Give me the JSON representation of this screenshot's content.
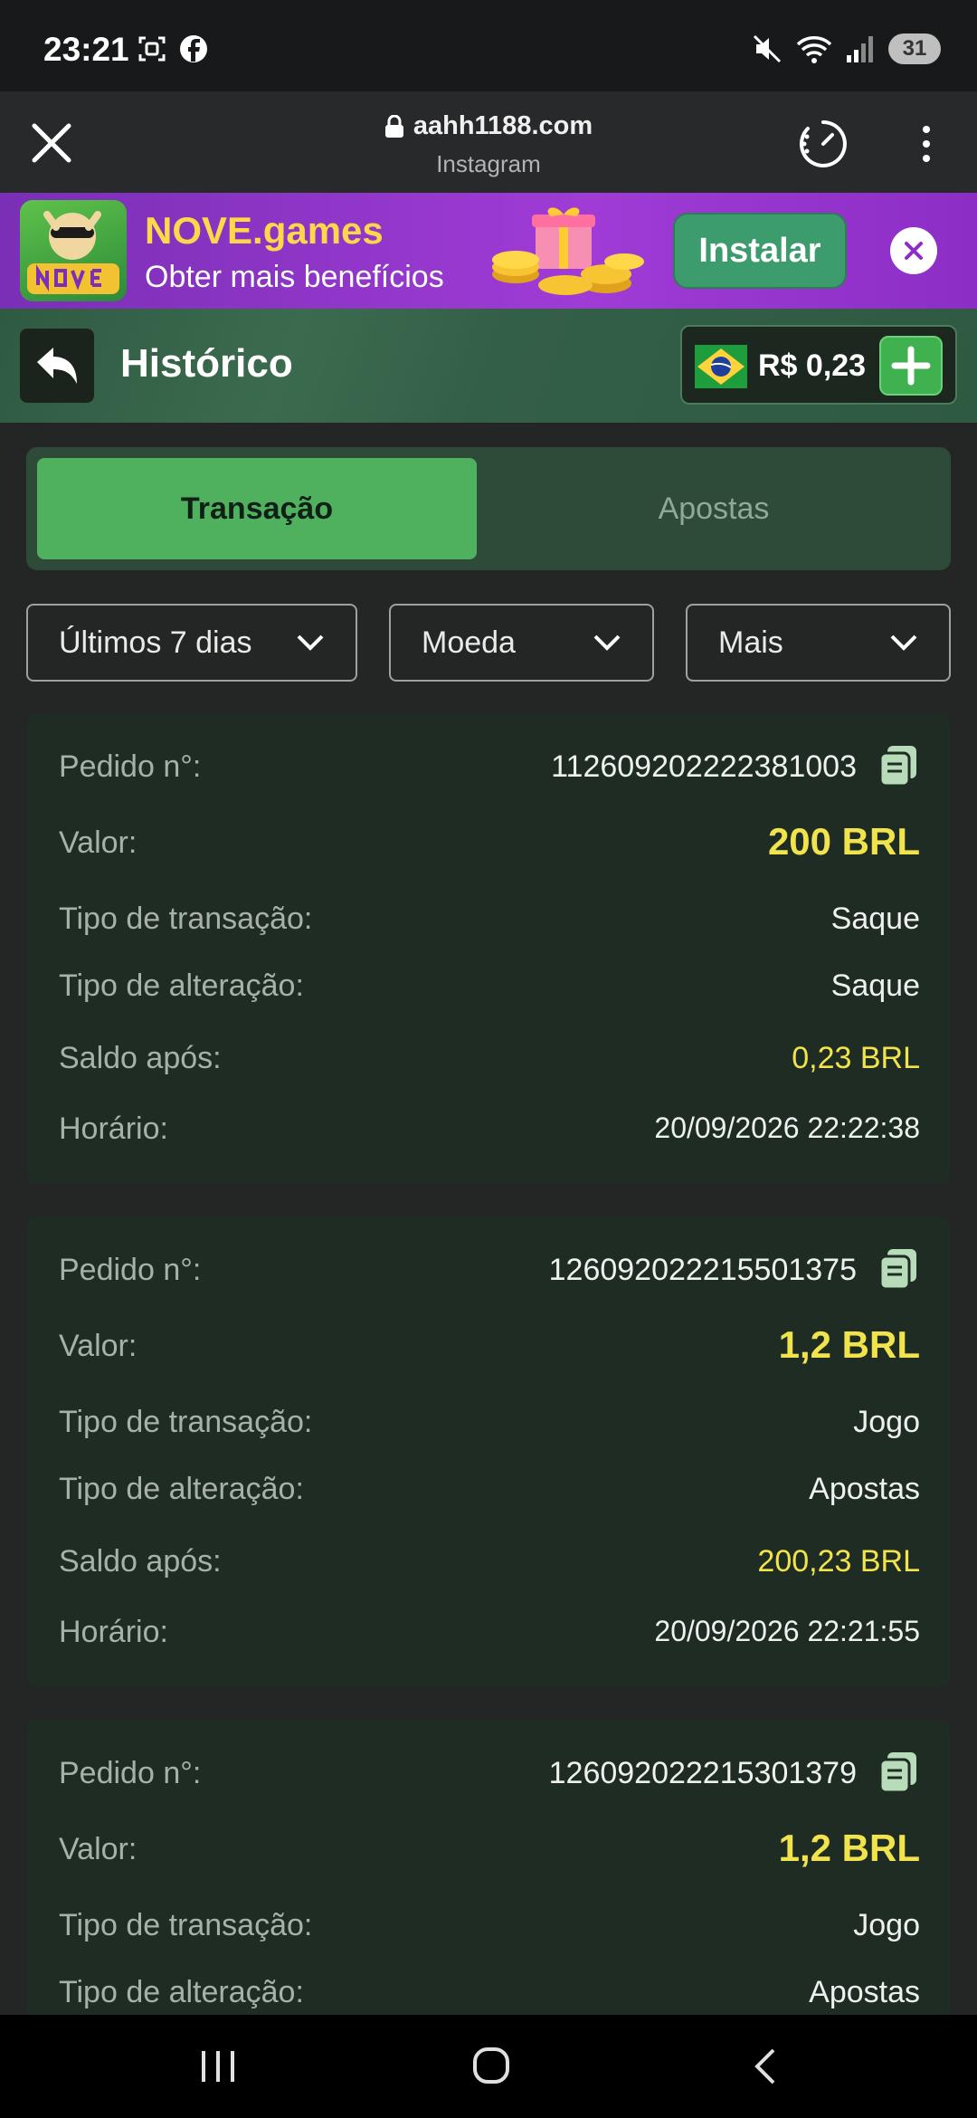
{
  "status_bar": {
    "time": "23:21",
    "battery": "31",
    "left_icons": [
      "screenshot-icon",
      "facebook-icon"
    ],
    "right_icons": [
      "mute-icon",
      "wifi-icon",
      "signal-icon",
      "battery-icon"
    ]
  },
  "browser": {
    "host": "aahh1188.com",
    "subtitle": "Instagram"
  },
  "promo": {
    "title": "NOVE.games",
    "subtitle": "Obter mais benefícios",
    "install_label": "Instalar",
    "logo_text": "NOVE GAMES"
  },
  "header": {
    "title": "Histórico",
    "balance": "R$ 0,23"
  },
  "tabs": [
    {
      "label": "Transação",
      "active": true
    },
    {
      "label": "Apostas",
      "active": false
    }
  ],
  "filters": [
    {
      "label": "Últimos 7 dias"
    },
    {
      "label": "Moeda"
    },
    {
      "label": "Mais"
    }
  ],
  "labels": {
    "order": "Pedido n°:",
    "value": "Valor:",
    "transaction_type": "Tipo de transação:",
    "change_type": "Tipo de alteração:",
    "balance_after": "Saldo após:",
    "time": "Horário:"
  },
  "transactions": [
    {
      "order": "112609202222381003",
      "value": "200 BRL",
      "transaction_type": "Saque",
      "change_type": "Saque",
      "balance_after": "0,23 BRL",
      "time": "20/09/2026 22:22:38"
    },
    {
      "order": "126092022215501375",
      "value": "1,2 BRL",
      "transaction_type": "Jogo",
      "change_type": "Apostas",
      "balance_after": "200,23 BRL",
      "time": "20/09/2026 22:21:55"
    },
    {
      "order": "126092022215301379",
      "value": "1,2 BRL",
      "transaction_type": "Jogo",
      "change_type": "Apostas"
    }
  ],
  "colors": {
    "accent_green": "#4fb15d",
    "value_yellow": "#f1e34c",
    "card_bg": "#1e2c23",
    "page_bg": "#232624"
  }
}
